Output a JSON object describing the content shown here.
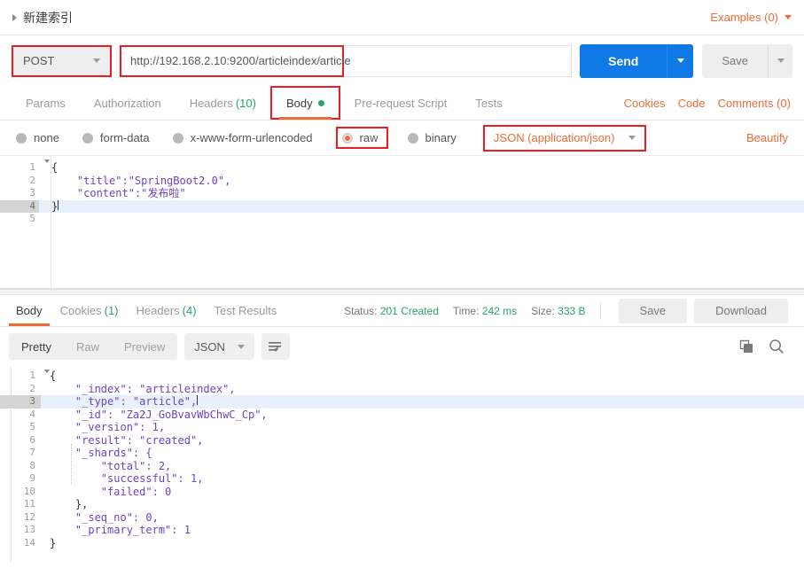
{
  "request": {
    "title": "新建索引",
    "examples_label": "Examples (0)",
    "method": "POST",
    "url": "http://192.168.2.10:9200/articleindex/article",
    "send_label": "Send",
    "save_label": "Save",
    "tabs": [
      {
        "label": "Params",
        "count": "",
        "active": false
      },
      {
        "label": "Authorization",
        "count": "",
        "active": false
      },
      {
        "label": "Headers",
        "count": "(10)",
        "active": false
      },
      {
        "label": "Body",
        "count": "",
        "active": true
      },
      {
        "label": "Pre-request Script",
        "count": "",
        "active": false
      },
      {
        "label": "Tests",
        "count": "",
        "active": false
      }
    ],
    "links": [
      {
        "label": "Cookies"
      },
      {
        "label": "Code"
      },
      {
        "label": "Comments (0)"
      }
    ],
    "body_types": [
      {
        "label": "none",
        "selected": false
      },
      {
        "label": "form-data",
        "selected": false
      },
      {
        "label": "x-www-form-urlencoded",
        "selected": false
      },
      {
        "label": "raw",
        "selected": true
      },
      {
        "label": "binary",
        "selected": false
      }
    ],
    "content_type": "JSON (application/json)",
    "beautify_label": "Beautify",
    "body_lines": [
      {
        "n": "1",
        "text": "{",
        "fold": true,
        "hl": false
      },
      {
        "n": "2",
        "text": "    \"title\":\"SpringBoot2.0\",",
        "fold": false,
        "hl": false
      },
      {
        "n": "3",
        "text": "    \"content\":\"发布啦\"",
        "fold": false,
        "hl": false
      },
      {
        "n": "4",
        "text": "}",
        "fold": false,
        "hl": true
      },
      {
        "n": "5",
        "text": "",
        "fold": false,
        "hl": false
      }
    ]
  },
  "response": {
    "tabs": [
      {
        "label": "Body",
        "count": "",
        "active": true
      },
      {
        "label": "Cookies",
        "count": "(1)",
        "active": false
      },
      {
        "label": "Headers",
        "count": "(4)",
        "active": false
      },
      {
        "label": "Test Results",
        "count": "",
        "active": false
      }
    ],
    "status_label": "Status:",
    "status_value": "201 Created",
    "time_label": "Time:",
    "time_value": "242 ms",
    "size_label": "Size:",
    "size_value": "333 B",
    "save_label": "Save",
    "download_label": "Download",
    "view_modes": [
      {
        "label": "Pretty",
        "active": true
      },
      {
        "label": "Raw",
        "active": false
      },
      {
        "label": "Preview",
        "active": false
      }
    ],
    "format": "JSON",
    "body_lines": [
      {
        "n": "1",
        "text": "{",
        "fold": true,
        "hl": false
      },
      {
        "n": "2",
        "text": "    \"_index\": \"articleindex\",",
        "fold": false,
        "hl": false
      },
      {
        "n": "3",
        "text": "    \"_type\": \"article\",",
        "fold": false,
        "hl": true
      },
      {
        "n": "4",
        "text": "    \"_id\": \"Za2J_GoBvavWbChwC_Cp\",",
        "fold": false,
        "hl": false
      },
      {
        "n": "5",
        "text": "    \"_version\": 1,",
        "fold": false,
        "hl": false
      },
      {
        "n": "6",
        "text": "    \"result\": \"created\",",
        "fold": false,
        "hl": false
      },
      {
        "n": "7",
        "text": "    \"_shards\": {",
        "fold": true,
        "hl": false
      },
      {
        "n": "8",
        "text": "        \"total\": 2,",
        "fold": false,
        "hl": false
      },
      {
        "n": "9",
        "text": "        \"successful\": 1,",
        "fold": false,
        "hl": false
      },
      {
        "n": "10",
        "text": "        \"failed\": 0",
        "fold": false,
        "hl": false
      },
      {
        "n": "11",
        "text": "    },",
        "fold": false,
        "hl": false
      },
      {
        "n": "12",
        "text": "    \"_seq_no\": 0,",
        "fold": false,
        "hl": false
      },
      {
        "n": "13",
        "text": "    \"_primary_term\": 1",
        "fold": false,
        "hl": false
      },
      {
        "n": "14",
        "text": "}",
        "fold": false,
        "hl": false
      }
    ]
  },
  "colors": {
    "accent_orange": "#f06a35",
    "send_blue": "#0f7ae5",
    "green": "#27a567",
    "highlight_red": "#ee1d24",
    "string_purple": "#6f43c0",
    "number_blue": "#1750c4"
  }
}
